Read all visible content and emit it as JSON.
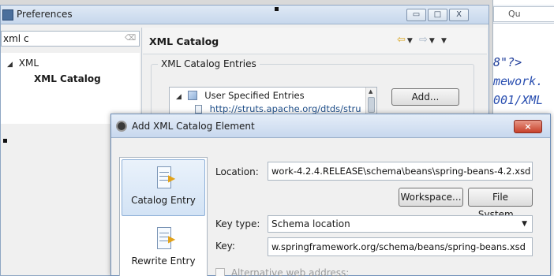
{
  "preferences": {
    "title": "Preferences",
    "filter_value": "xml c",
    "tree": {
      "parent": "XML",
      "child": "XML Catalog"
    },
    "page_title": "XML Catalog",
    "group_label": "XML Catalog Entries",
    "entries": {
      "root": "User Specified Entries",
      "child": "http://struts.apache.org/dtds/stru"
    },
    "add_label": "Add...",
    "window_buttons": {
      "minimize": "▭",
      "maximize": "□",
      "close": "X"
    }
  },
  "editor": {
    "quick_access": "Qu",
    "code_lines": [
      "8\"?>",
      "mework.",
      "001/XML"
    ]
  },
  "dialog": {
    "title": "Add XML Catalog Element",
    "close_label": "×",
    "types": [
      {
        "label": "Catalog Entry",
        "selected": true
      },
      {
        "label": "Rewrite Entry",
        "selected": false
      }
    ],
    "location_label": "Location:",
    "location_value": "work-4.2.4.RELEASE\\schema\\beans\\spring-beans-4.2.xsd",
    "workspace_label": "Workspace...",
    "file_system_label": "File System...",
    "key_type_label": "Key type:",
    "key_type_value": "Schema location",
    "key_label": "Key:",
    "key_value": "w.springframework.org/schema/beans/spring-beans.xsd",
    "alternative_label": "Alternative web address:"
  }
}
